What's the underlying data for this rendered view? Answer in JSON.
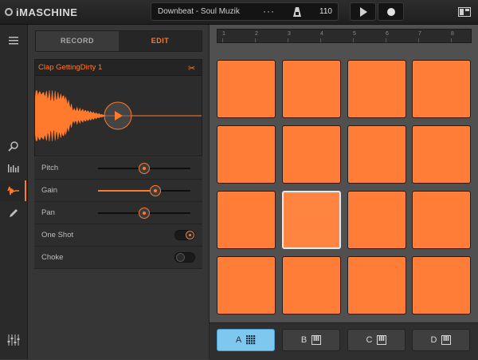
{
  "app": {
    "title": "iMASCHINE"
  },
  "transport": {
    "project_name": "Downbeat - Soul Muzik",
    "more_label": "···",
    "tempo": "110",
    "play_icon": "play-icon",
    "record_icon": "record-icon"
  },
  "sidebar": {
    "items": [
      {
        "name": "menu-icon"
      },
      {
        "name": "search-icon"
      },
      {
        "name": "sequencer-icon"
      },
      {
        "name": "waveform-icon",
        "active": true
      },
      {
        "name": "pencil-icon"
      },
      {
        "name": "mixer-icon"
      }
    ]
  },
  "panel": {
    "tabs": {
      "record": "RECORD",
      "edit": "EDIT"
    },
    "sample_title": "Clap GettingDirty 1",
    "params": [
      {
        "label": "Pitch",
        "value": 0.5
      },
      {
        "label": "Gain",
        "value": 0.62
      },
      {
        "label": "Pan",
        "value": 0.5
      }
    ],
    "toggles": [
      {
        "label": "One Shot",
        "on": true
      },
      {
        "label": "Choke",
        "on": false
      }
    ]
  },
  "timeline": {
    "bars": [
      "1",
      "2",
      "3",
      "4",
      "5",
      "6",
      "7",
      "8"
    ]
  },
  "pads": {
    "count": 16,
    "selected_index": 9
  },
  "groups": [
    {
      "label": "A",
      "icon": "grid-icon",
      "selected": true
    },
    {
      "label": "B",
      "icon": "keyboard-icon",
      "selected": false
    },
    {
      "label": "C",
      "icon": "keyboard-icon",
      "selected": false
    },
    {
      "label": "D",
      "icon": "keyboard-icon",
      "selected": false
    }
  ],
  "colors": {
    "accent": "#ff7a2c",
    "pad": "#ff7d36",
    "group_selected": "#7ec8ef"
  }
}
